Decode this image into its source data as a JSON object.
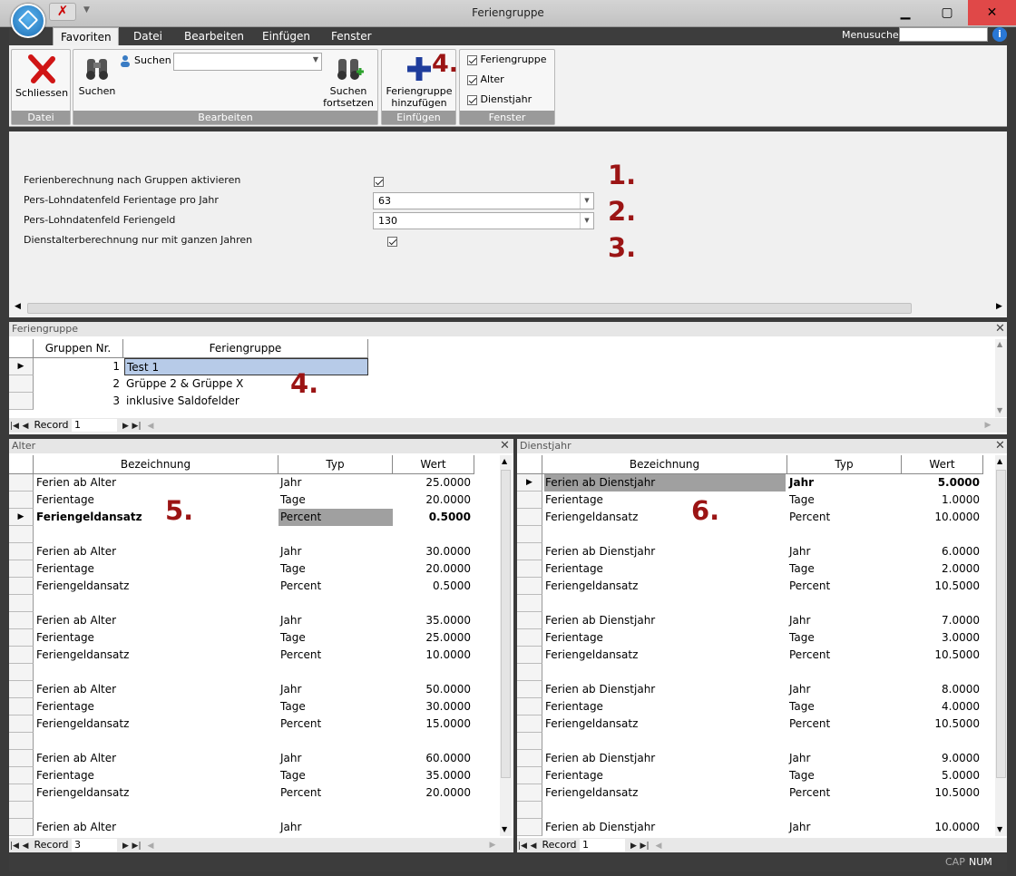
{
  "window": {
    "title": "Feriengruppe",
    "minimize": "▁",
    "maximize": "▢",
    "close": "✕"
  },
  "tabs": [
    {
      "label": "Favoriten"
    },
    {
      "label": "Datei"
    },
    {
      "label": "Bearbeiten"
    },
    {
      "label": "Einfügen"
    },
    {
      "label": "Fenster"
    }
  ],
  "menusuche": {
    "label": "Menusuche",
    "value": ""
  },
  "ribbon": {
    "datei": {
      "label": "Datei",
      "schliessen": "Schliessen"
    },
    "bearbeiten": {
      "label": "Bearbeiten",
      "suchen_btn": "Suchen",
      "suchen_field_label": "Suchen",
      "suchen_value": "",
      "fortsetzen_line1": "Suchen",
      "fortsetzen_line2": "fortsetzen"
    },
    "einfuegen": {
      "label": "Einfügen",
      "add_line1": "Feriengruppe",
      "add_line2": "hinzufügen"
    },
    "fenster": {
      "label": "Fenster",
      "items": [
        "Feriengruppe",
        "Alter",
        "Dienstjahr"
      ]
    }
  },
  "annotations": {
    "n1": "1.",
    "n2": "2.",
    "n3": "3.",
    "n4a": "4.",
    "n4b": "4.",
    "n5": "5.",
    "n6": "6."
  },
  "settings": {
    "row1_label": "Ferienberechnung nach Gruppen aktivieren",
    "row2_label": "Pers-Lohndatenfeld Ferientage pro Jahr",
    "row2_value": "63",
    "row3_label": "Pers-Lohndatenfeld Feriengeld",
    "row3_value": "130",
    "row4_label": "Dienstalterberechnung nur mit ganzen Jahren"
  },
  "feriengruppe": {
    "title": "Feriengruppe",
    "headers": [
      "Gruppen Nr.",
      "Feriengruppe"
    ],
    "rows": [
      {
        "nr": "1",
        "name": "Test 1"
      },
      {
        "nr": "2",
        "name": "Grüppe 2 & Grüppe X"
      },
      {
        "nr": "3",
        "name": "inklusive Saldofelder"
      }
    ],
    "record_label": "Record",
    "record_value": "1"
  },
  "alter": {
    "title": "Alter",
    "headers": [
      "Bezeichnung",
      "Typ",
      "Wert"
    ],
    "rows": [
      [
        "Ferien ab Alter",
        "Jahr",
        "25.0000"
      ],
      [
        "Ferientage",
        "Tage",
        "20.0000"
      ],
      [
        "Feriengeldansatz",
        "Percent",
        "0.5000"
      ],
      [
        "",
        "",
        ""
      ],
      [
        "Ferien ab Alter",
        "Jahr",
        "30.0000"
      ],
      [
        "Ferientage",
        "Tage",
        "20.0000"
      ],
      [
        "Feriengeldansatz",
        "Percent",
        "0.5000"
      ],
      [
        "",
        "",
        ""
      ],
      [
        "Ferien ab Alter",
        "Jahr",
        "35.0000"
      ],
      [
        "Ferientage",
        "Tage",
        "25.0000"
      ],
      [
        "Feriengeldansatz",
        "Percent",
        "10.0000"
      ],
      [
        "",
        "",
        ""
      ],
      [
        "Ferien ab Alter",
        "Jahr",
        "50.0000"
      ],
      [
        "Ferientage",
        "Tage",
        "30.0000"
      ],
      [
        "Feriengeldansatz",
        "Percent",
        "15.0000"
      ],
      [
        "",
        "",
        ""
      ],
      [
        "Ferien ab Alter",
        "Jahr",
        "60.0000"
      ],
      [
        "Ferientage",
        "Tage",
        "35.0000"
      ],
      [
        "Feriengeldansatz",
        "Percent",
        "20.0000"
      ],
      [
        "",
        "",
        ""
      ],
      [
        "Ferien ab Alter",
        "Jahr",
        ""
      ]
    ],
    "record_label": "Record",
    "record_value": "3"
  },
  "dienstjahr": {
    "title": "Dienstjahr",
    "headers": [
      "Bezeichnung",
      "Typ",
      "Wert"
    ],
    "rows": [
      [
        "Ferien ab Dienstjahr",
        "Jahr",
        "5.0000"
      ],
      [
        "Ferientage",
        "Tage",
        "1.0000"
      ],
      [
        "Feriengeldansatz",
        "Percent",
        "10.0000"
      ],
      [
        "",
        "",
        ""
      ],
      [
        "Ferien ab Dienstjahr",
        "Jahr",
        "6.0000"
      ],
      [
        "Ferientage",
        "Tage",
        "2.0000"
      ],
      [
        "Feriengeldansatz",
        "Percent",
        "10.5000"
      ],
      [
        "",
        "",
        ""
      ],
      [
        "Ferien ab Dienstjahr",
        "Jahr",
        "7.0000"
      ],
      [
        "Ferientage",
        "Tage",
        "3.0000"
      ],
      [
        "Feriengeldansatz",
        "Percent",
        "10.5000"
      ],
      [
        "",
        "",
        ""
      ],
      [
        "Ferien ab Dienstjahr",
        "Jahr",
        "8.0000"
      ],
      [
        "Ferientage",
        "Tage",
        "4.0000"
      ],
      [
        "Feriengeldansatz",
        "Percent",
        "10.5000"
      ],
      [
        "",
        "",
        ""
      ],
      [
        "Ferien ab Dienstjahr",
        "Jahr",
        "9.0000"
      ],
      [
        "Ferientage",
        "Tage",
        "5.0000"
      ],
      [
        "Feriengeldansatz",
        "Percent",
        "10.5000"
      ],
      [
        "",
        "",
        ""
      ],
      [
        "Ferien ab Dienstjahr",
        "Jahr",
        "10.0000"
      ]
    ],
    "record_label": "Record",
    "record_value": "1"
  },
  "status": {
    "cap": "CAP",
    "num": "NUM"
  }
}
